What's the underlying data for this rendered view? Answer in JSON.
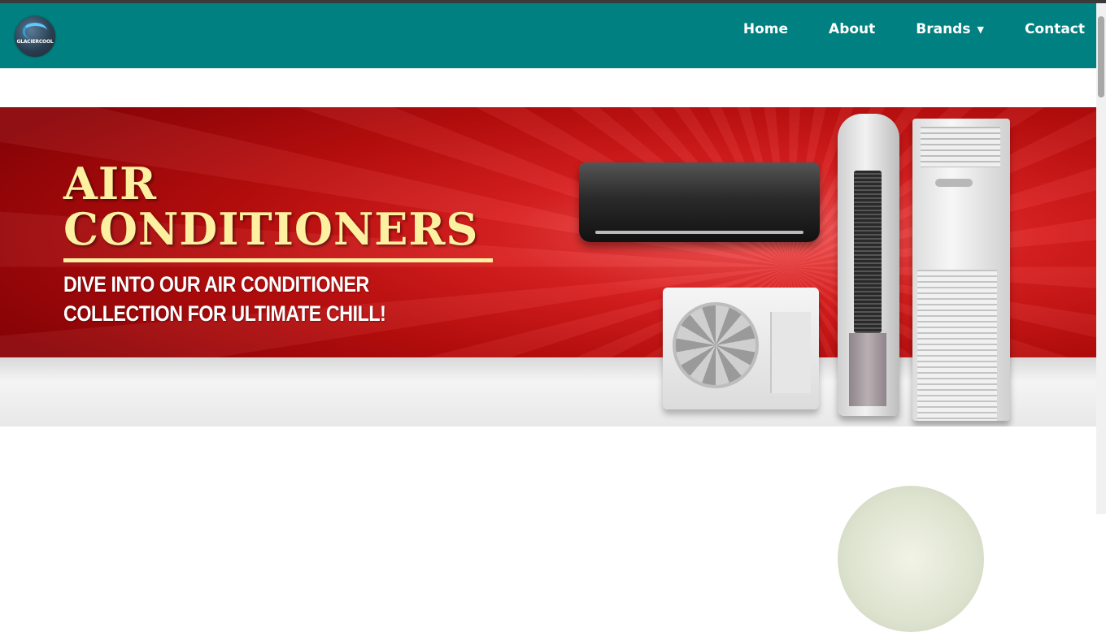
{
  "brand": {
    "logo_text": "GLACIERCOOL"
  },
  "nav": {
    "items": [
      {
        "label": "Home"
      },
      {
        "label": "About"
      },
      {
        "label": "Brands",
        "has_dropdown": true,
        "caret": "▼"
      },
      {
        "label": "Contact"
      }
    ]
  },
  "hero": {
    "title_line1": "AIR",
    "title_line2": "CONDITIONERS",
    "subtitle_line1": "DIVE INTO OUR AIR CONDITIONER",
    "subtitle_line2": "COLLECTION FOR ULTIMATE CHILL!"
  },
  "colors": {
    "navbar": "#008080",
    "banner_red": "#b80d0d",
    "title_yellow": "#fdf0a0"
  }
}
